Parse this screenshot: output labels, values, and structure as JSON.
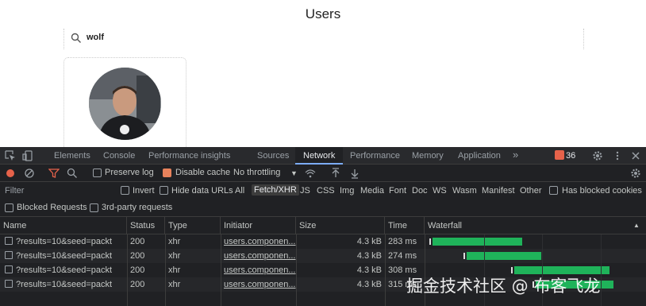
{
  "page": {
    "title": "Users",
    "search_value": "wolf"
  },
  "devtools": {
    "tabs": [
      "Elements",
      "Console",
      "Performance insights",
      "Sources",
      "Network",
      "Performance",
      "Memory",
      "Application"
    ],
    "active_tab": "Network",
    "issues_count": "36",
    "toolbar": {
      "preserve_log": "Preserve log",
      "disable_cache": "Disable cache",
      "throttling": "No throttling"
    },
    "filter": {
      "label": "Filter",
      "invert": "Invert",
      "hide_data_urls": "Hide data URLs",
      "types": [
        "All",
        "Fetch/XHR",
        "JS",
        "CSS",
        "Img",
        "Media",
        "Font",
        "Doc",
        "WS",
        "Wasm",
        "Manifest",
        "Other"
      ],
      "selected_type": "Fetch/XHR",
      "has_blocked_cookies": "Has blocked cookies",
      "blocked_requests": "Blocked Requests",
      "third_party": "3rd-party requests"
    },
    "table": {
      "headers": [
        "Name",
        "Status",
        "Type",
        "Initiator",
        "Size",
        "Time",
        "Waterfall"
      ],
      "rows": [
        {
          "name": "?results=10&seed=packt",
          "status": "200",
          "type": "xhr",
          "initiator": "users.componen...",
          "size": "4.3 kB",
          "time": "283 ms"
        },
        {
          "name": "?results=10&seed=packt",
          "status": "200",
          "type": "xhr",
          "initiator": "users.componen...",
          "size": "4.3 kB",
          "time": "274 ms"
        },
        {
          "name": "?results=10&seed=packt",
          "status": "200",
          "type": "xhr",
          "initiator": "users.componen...",
          "size": "4.3 kB",
          "time": "308 ms"
        },
        {
          "name": "?results=10&seed=packt",
          "status": "200",
          "type": "xhr",
          "initiator": "users.componen...",
          "size": "4.3 kB",
          "time": "315 ms"
        }
      ],
      "waterfall": [
        {
          "start": 0.03,
          "end": 0.5
        },
        {
          "start": 0.21,
          "end": 0.6
        },
        {
          "start": 0.46,
          "end": 0.96
        },
        {
          "start": 0.57,
          "end": 0.98
        }
      ]
    }
  },
  "watermark": "掘金技术社区 @ 布客飞龙",
  "colors": {
    "devtools_bg": "#202124",
    "accent": "#7cacf8",
    "waterfall_bar": "#1fb35a",
    "record": "#e6624a"
  }
}
